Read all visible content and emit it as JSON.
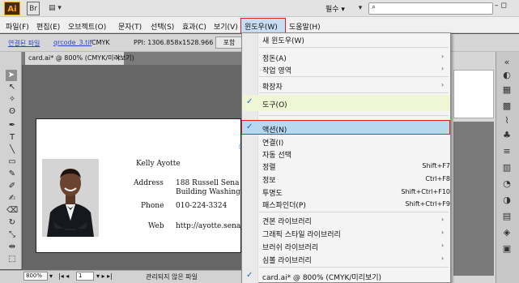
{
  "app": {
    "logo": "Ai",
    "bridge_label": "Br",
    "workspace": "필수"
  },
  "menubar": {
    "items": [
      "파일(F)",
      "편집(E)",
      "오브젝트(O)",
      "문자(T)",
      "선택(S)",
      "효과(C)",
      "보기(V)",
      "윈도우(W)",
      "도움말(H)"
    ]
  },
  "controlbar": {
    "embedded_link": "연결된 파일",
    "file_link": "qrcode_3.tif",
    "color_mode": "CMYK",
    "ppi": "PPI: 1306.858x1528.966",
    "embed_button": "포함"
  },
  "document": {
    "tab_label": "card.ai* @ 800% (CMYK/미리보기)",
    "close_glyph": "×"
  },
  "card": {
    "name": "Kelly Ayotte",
    "address_label": "Address",
    "address_line1": "188 Russell Sena",
    "address_line2": "Building Washing",
    "phone_label": "Phone",
    "phone_value": "010-224-3324",
    "web_label": "Web",
    "web_value": "http://ayotte.sena"
  },
  "statusbar": {
    "zoom": "800%",
    "page": "1",
    "status_text": "관리되지 않은 파일"
  },
  "window_menu": {
    "new_window": "새 윈도우(W)",
    "arrange": "정돈(A)",
    "workspace": "작업 영역",
    "extensions": "확장자",
    "tools": "도구(O)",
    "actions": "액션(N)",
    "links": "연결(I)",
    "auto_select": "자동 선택",
    "align": "정렬",
    "align_shortcut": "Shift+F7",
    "info": "정보",
    "info_shortcut": "Ctrl+F8",
    "transparency": "투명도",
    "transparency_shortcut": "Shift+Ctrl+F10",
    "pathfinder": "패스파인더(P)",
    "pathfinder_shortcut": "Shift+Ctrl+F9",
    "swatch_libraries": "견본 라이브러리",
    "graphic_style_libraries": "그래픽 스타일 라이브러리",
    "brush_libraries": "브러쉬 라이브러리",
    "symbol_libraries": "심볼 라이브러리",
    "open_document": "card.ai* @ 800% (CMYK/미리보기)"
  },
  "colors": {
    "highlight": "#b8d8f0",
    "highlight_border": "#dd2222",
    "ai_brand": "#f7a124"
  }
}
